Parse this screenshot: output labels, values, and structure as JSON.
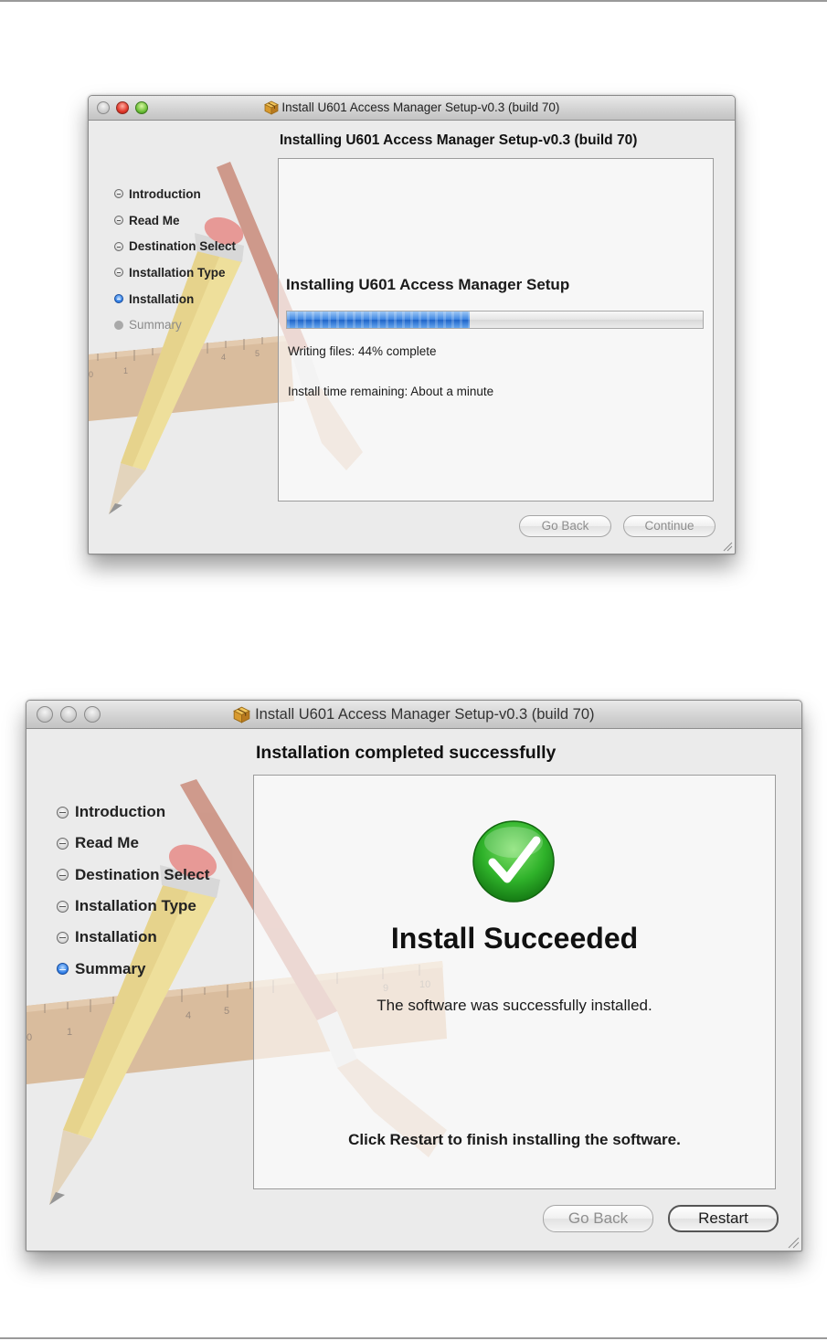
{
  "screens": [
    {
      "window_title": "Install U601 Access Manager Setup-v0.3 (build 70)",
      "heading": "Installing U601 Access Manager Setup-v0.3 (build 70)",
      "steps": [
        {
          "label": "Introduction",
          "state": "done"
        },
        {
          "label": "Read Me",
          "state": "done"
        },
        {
          "label": "Destination Select",
          "state": "done"
        },
        {
          "label": "Installation Type",
          "state": "done"
        },
        {
          "label": "Installation",
          "state": "current"
        },
        {
          "label": "Summary",
          "state": "pending"
        }
      ],
      "status_title": "Installing U601 Access Manager Setup",
      "progress_fraction": 0.44,
      "progress_text": "Writing files: 44% complete",
      "time_remaining": "Install time remaining: About a minute",
      "buttons": {
        "back": "Go Back",
        "next": "Continue"
      }
    },
    {
      "window_title": "Install U601 Access Manager Setup-v0.3 (build 70)",
      "heading": "Installation completed successfully",
      "steps": [
        {
          "label": "Introduction",
          "state": "done"
        },
        {
          "label": "Read Me",
          "state": "done"
        },
        {
          "label": "Destination Select",
          "state": "done"
        },
        {
          "label": "Installation Type",
          "state": "done"
        },
        {
          "label": "Installation",
          "state": "done"
        },
        {
          "label": "Summary",
          "state": "current"
        }
      ],
      "result_title": "Install Succeeded",
      "result_message": "The software was successfully installed.",
      "footer_message": "Click Restart to finish installing the software.",
      "buttons": {
        "back": "Go Back",
        "next": "Restart"
      }
    }
  ],
  "icons": {
    "installer_package": "package-icon",
    "success": "checkmark-circle-icon",
    "background_art": "pencil-ruler-brush-artwork"
  },
  "colors": {
    "success_green": "#2fb22a",
    "progress_blue": "#3f86e2",
    "current_step_blue": "#2f7ee6"
  }
}
